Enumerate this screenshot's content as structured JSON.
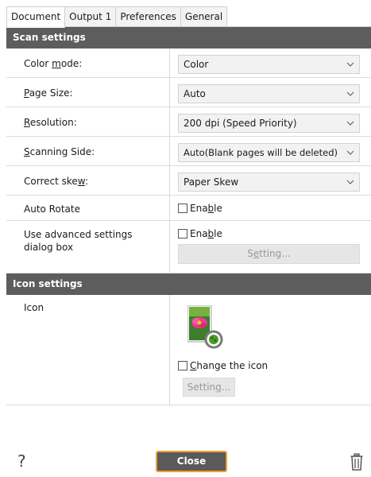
{
  "tabs": [
    "Document",
    "Output 1",
    "Preferences",
    "General"
  ],
  "scan_settings": {
    "header": "Scan settings",
    "color_mode": {
      "label_pre": "Color ",
      "label_u": "m",
      "label_post": "ode:",
      "value": "Color"
    },
    "page_size": {
      "label_pre": "",
      "label_u": "P",
      "label_post": "age Size:",
      "value": "Auto"
    },
    "resolution": {
      "label_pre": "",
      "label_u": "R",
      "label_post": "esolution:",
      "value": "200 dpi (Speed Priority)"
    },
    "scanning_side": {
      "label_pre": "",
      "label_u": "S",
      "label_post": "canning Side:",
      "value": "Auto(Blank pages will be deleted)"
    },
    "correct_skew": {
      "label_pre": "Correct ske",
      "label_u": "w",
      "label_post": ":",
      "value": "Paper Skew"
    },
    "auto_rotate": {
      "label": "Auto Rotate",
      "check_pre": "Ena",
      "check_u": "b",
      "check_post": "le"
    },
    "advanced": {
      "label": "Use advanced settings dialog box",
      "check_pre": "Ena",
      "check_u": "b",
      "check_post": "le",
      "setting_pre": "S",
      "setting_u": "e",
      "setting_post": "tting..."
    }
  },
  "icon_settings": {
    "header": "Icon settings",
    "icon_label": "Icon",
    "change_pre": "",
    "change_u": "C",
    "change_post": "hange the icon",
    "setting_pre": "Settin",
    "setting_u": "g",
    "setting_post": "..."
  },
  "footer": {
    "help": "?",
    "close": "Close"
  },
  "icons": [
    "chevron-down-icon",
    "help-icon",
    "trash-icon",
    "picture-icon"
  ],
  "colors": {
    "header_bg": "#5d5d5d",
    "close_border": "#f0a030",
    "close_bg": "#5a5a5a"
  }
}
